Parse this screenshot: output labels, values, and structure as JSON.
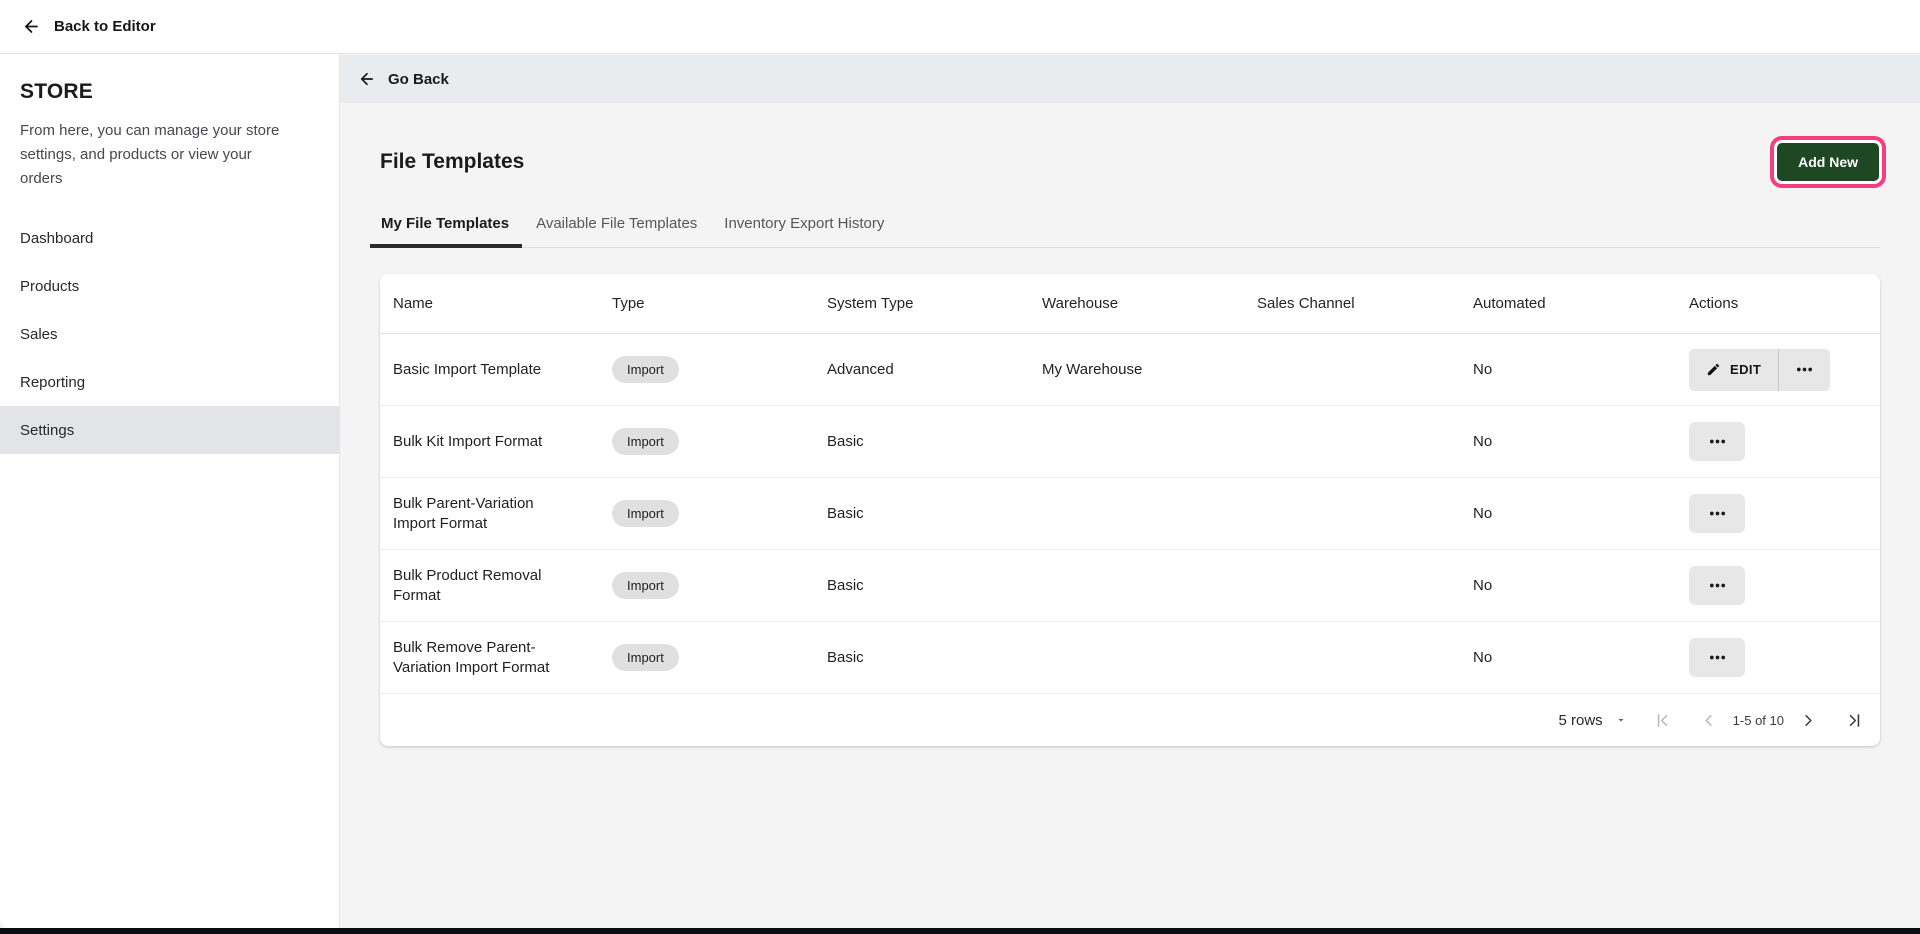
{
  "top_bar": {
    "back_label": "Back to Editor"
  },
  "sidebar": {
    "title": "STORE",
    "description": "From here, you can manage your store settings, and products or view your orders",
    "items": [
      {
        "label": "Dashboard",
        "active": false
      },
      {
        "label": "Products",
        "active": false
      },
      {
        "label": "Sales",
        "active": false
      },
      {
        "label": "Reporting",
        "active": false
      },
      {
        "label": "Settings",
        "active": true
      }
    ]
  },
  "content": {
    "go_back_label": "Go Back",
    "page_title": "File Templates",
    "add_new_label": "Add New",
    "tabs": [
      {
        "label": "My File Templates",
        "active": true
      },
      {
        "label": "Available File Templates",
        "active": false
      },
      {
        "label": "Inventory Export History",
        "active": false
      }
    ],
    "table": {
      "columns": [
        "Name",
        "Type",
        "System Type",
        "Warehouse",
        "Sales Channel",
        "Automated",
        "Actions"
      ],
      "rows": [
        {
          "name": "Basic Import Template",
          "type_badge": "Import",
          "system_type": "Advanced",
          "warehouse": "My Warehouse",
          "sales_channel": "",
          "automated": "No",
          "edit_label": "EDIT",
          "has_edit": true
        },
        {
          "name": "Bulk Kit Import Format",
          "type_badge": "Import",
          "system_type": "Basic",
          "warehouse": "",
          "sales_channel": "",
          "automated": "No",
          "has_edit": false
        },
        {
          "name": "Bulk Parent-Variation Import Format",
          "type_badge": "Import",
          "system_type": "Basic",
          "warehouse": "",
          "sales_channel": "",
          "automated": "No",
          "has_edit": false
        },
        {
          "name": "Bulk Product Removal Format",
          "type_badge": "Import",
          "system_type": "Basic",
          "warehouse": "",
          "sales_channel": "",
          "automated": "No",
          "has_edit": false
        },
        {
          "name": "Bulk Remove Parent-Variation Import Format",
          "type_badge": "Import",
          "system_type": "Basic",
          "warehouse": "",
          "sales_channel": "",
          "automated": "No",
          "has_edit": false
        }
      ],
      "pagination": {
        "rows_per_page_label": "5 rows",
        "range_label": "1-5 of 10"
      }
    }
  },
  "icons": {
    "back": "arrow-left",
    "edit": "pencil",
    "row_menu": "ellipsis",
    "rows_per_page": "caret-down",
    "first_page": "first-page",
    "previous_page": "chevron-left",
    "next_page": "chevron-right",
    "last_page": "last-page"
  },
  "colors": {
    "accent_green": "#1e4823",
    "highlight_pink": "#f43f7f",
    "go_back_bar": "#e9ecee",
    "active_nav_bg": "#e3e4e8",
    "badge_bg": "#e0e0e0"
  }
}
